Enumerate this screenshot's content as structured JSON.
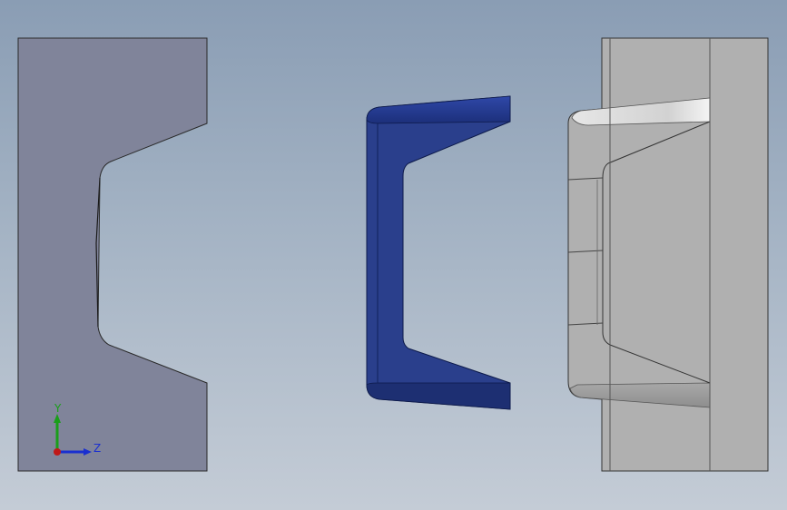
{
  "triad": {
    "y_label": "Y",
    "z_label": "Z",
    "y_color": "#1a9e1a",
    "z_color": "#1a2fd0",
    "x_color": "#c01818"
  },
  "parts": [
    {
      "name": "mold-half-left",
      "fill": "#80849a"
    },
    {
      "name": "u-channel-blue",
      "fill": "#2a3f8c"
    },
    {
      "name": "mold-half-right",
      "fill": "#b0b0b0"
    }
  ]
}
